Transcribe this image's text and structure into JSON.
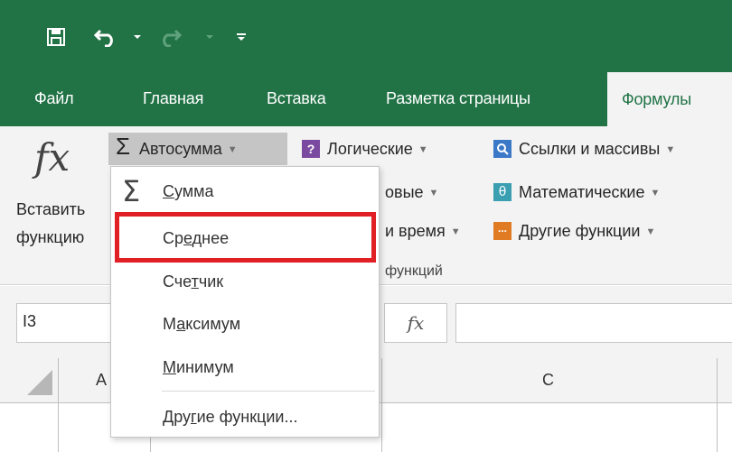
{
  "quick_access": {
    "icons": [
      "save-icon",
      "undo-icon",
      "redo-icon",
      "customize-icon"
    ]
  },
  "tabs": [
    {
      "label": "Файл"
    },
    {
      "label": "Главная"
    },
    {
      "label": "Вставка"
    },
    {
      "label": "Разметка страницы"
    },
    {
      "label": "Формулы",
      "active": true
    }
  ],
  "ribbon": {
    "insert_function_line1": "Вставить",
    "insert_function_line2": "функцию",
    "autosum_label": "Автосумма",
    "logical_label": "Логические",
    "text_partial_label": "овые",
    "datetime_partial_label": "и время",
    "lookup_label": "Ссылки и массивы",
    "math_label": "Математические",
    "more_label": "Другие функции",
    "group_label_partial": "функций"
  },
  "autosum_menu": {
    "items": [
      {
        "prefix": "",
        "key": "С",
        "suffix": "умма",
        "icon": "sigma-icon"
      },
      {
        "prefix": "Ср",
        "key": "е",
        "suffix": "днее",
        "highlighted": true
      },
      {
        "prefix": "Сче",
        "key": "т",
        "suffix": "чик"
      },
      {
        "prefix": "М",
        "key": "а",
        "suffix": "ксимум"
      },
      {
        "prefix": "",
        "key": "М",
        "suffix": "инимум"
      },
      {
        "prefix": "Дру",
        "key": "г",
        "suffix": "ие функции..."
      }
    ]
  },
  "formula_bar": {
    "name_box_value": "I3",
    "fx_symbol": "fx",
    "formula_value": ""
  },
  "grid": {
    "columns": [
      "A",
      "C"
    ]
  },
  "colors": {
    "excel_green": "#217346",
    "ribbon_bg": "#f3f3f3",
    "highlight_red": "#e02025"
  }
}
